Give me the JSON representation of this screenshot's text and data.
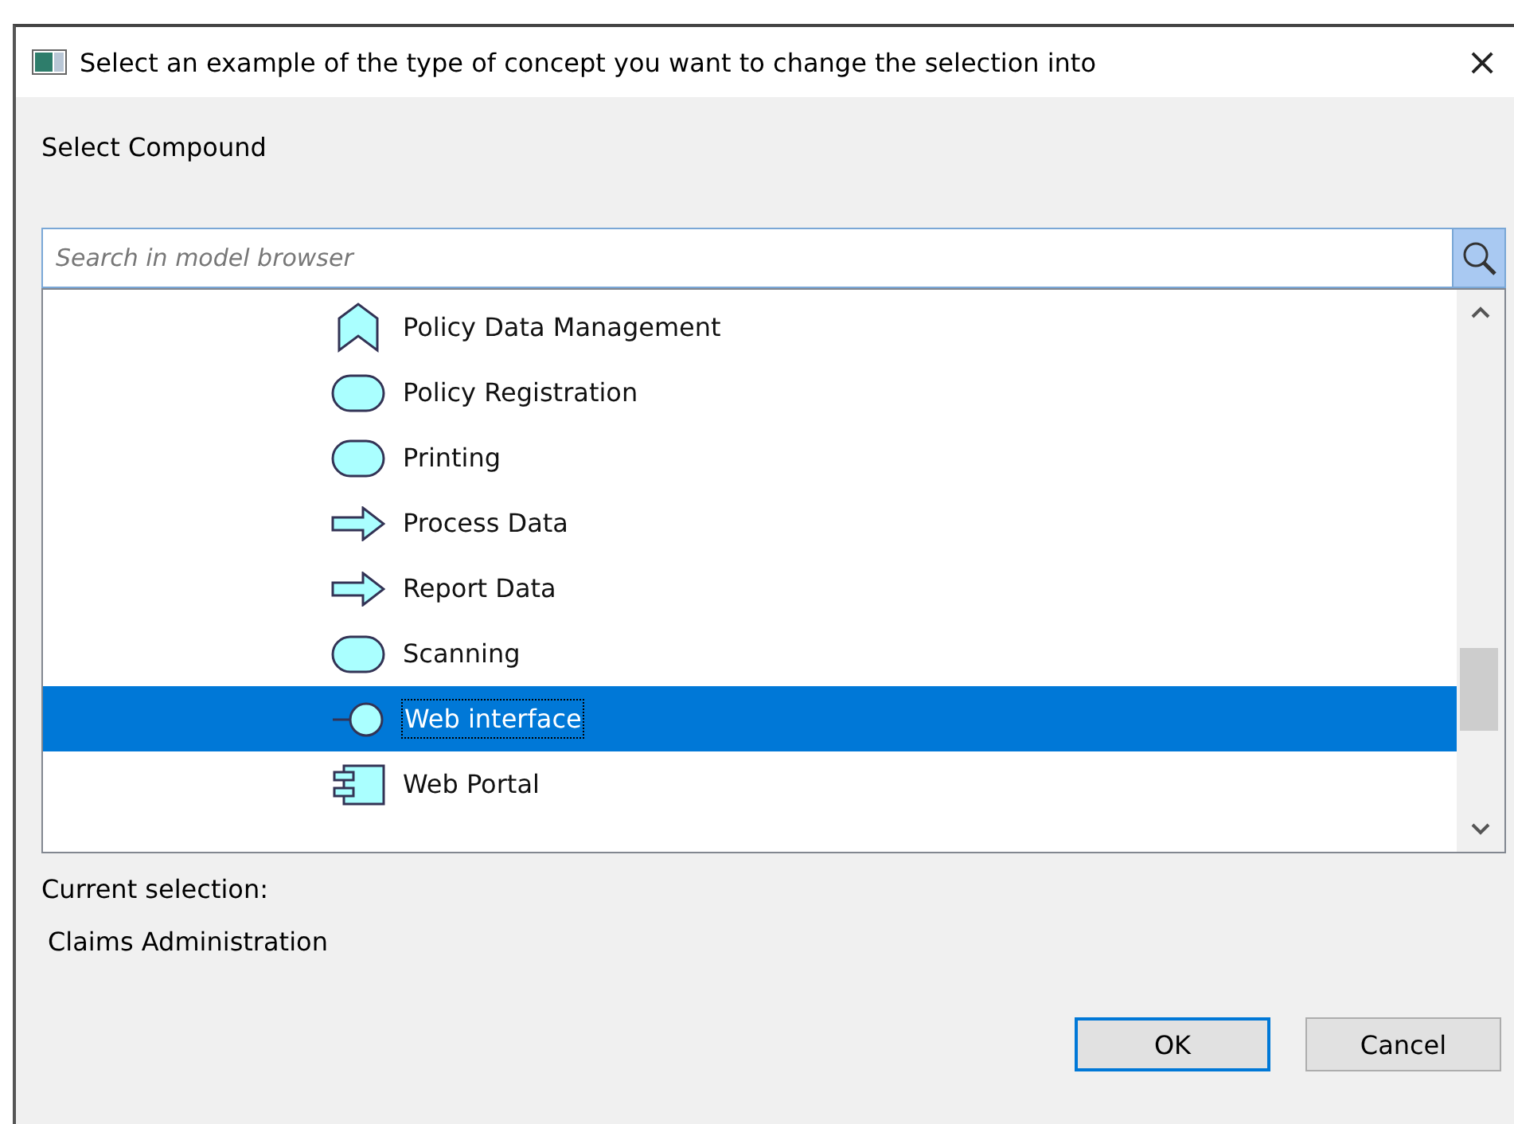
{
  "window": {
    "title": "Select an example of the type of concept you want to change the selection into",
    "close": "×"
  },
  "heading": "Select Compound",
  "search": {
    "placeholder": "Search in model browser"
  },
  "tree": {
    "items": [
      {
        "label": "Policy Data Management",
        "kind": "function",
        "selected": false
      },
      {
        "label": "Policy Registration",
        "kind": "service",
        "selected": false
      },
      {
        "label": "Printing",
        "kind": "service",
        "selected": false
      },
      {
        "label": "Process Data",
        "kind": "flow",
        "selected": false
      },
      {
        "label": "Report Data",
        "kind": "flow",
        "selected": false
      },
      {
        "label": "Scanning",
        "kind": "service",
        "selected": false
      },
      {
        "label": "Web interface",
        "kind": "interface",
        "selected": true
      },
      {
        "label": "Web Portal",
        "kind": "component",
        "selected": false
      }
    ]
  },
  "current_selection": {
    "label": "Current selection:",
    "value": "Claims Administration"
  },
  "buttons": [
    {
      "label": "OK",
      "default": true
    },
    {
      "label": "Cancel",
      "default": false
    }
  ]
}
